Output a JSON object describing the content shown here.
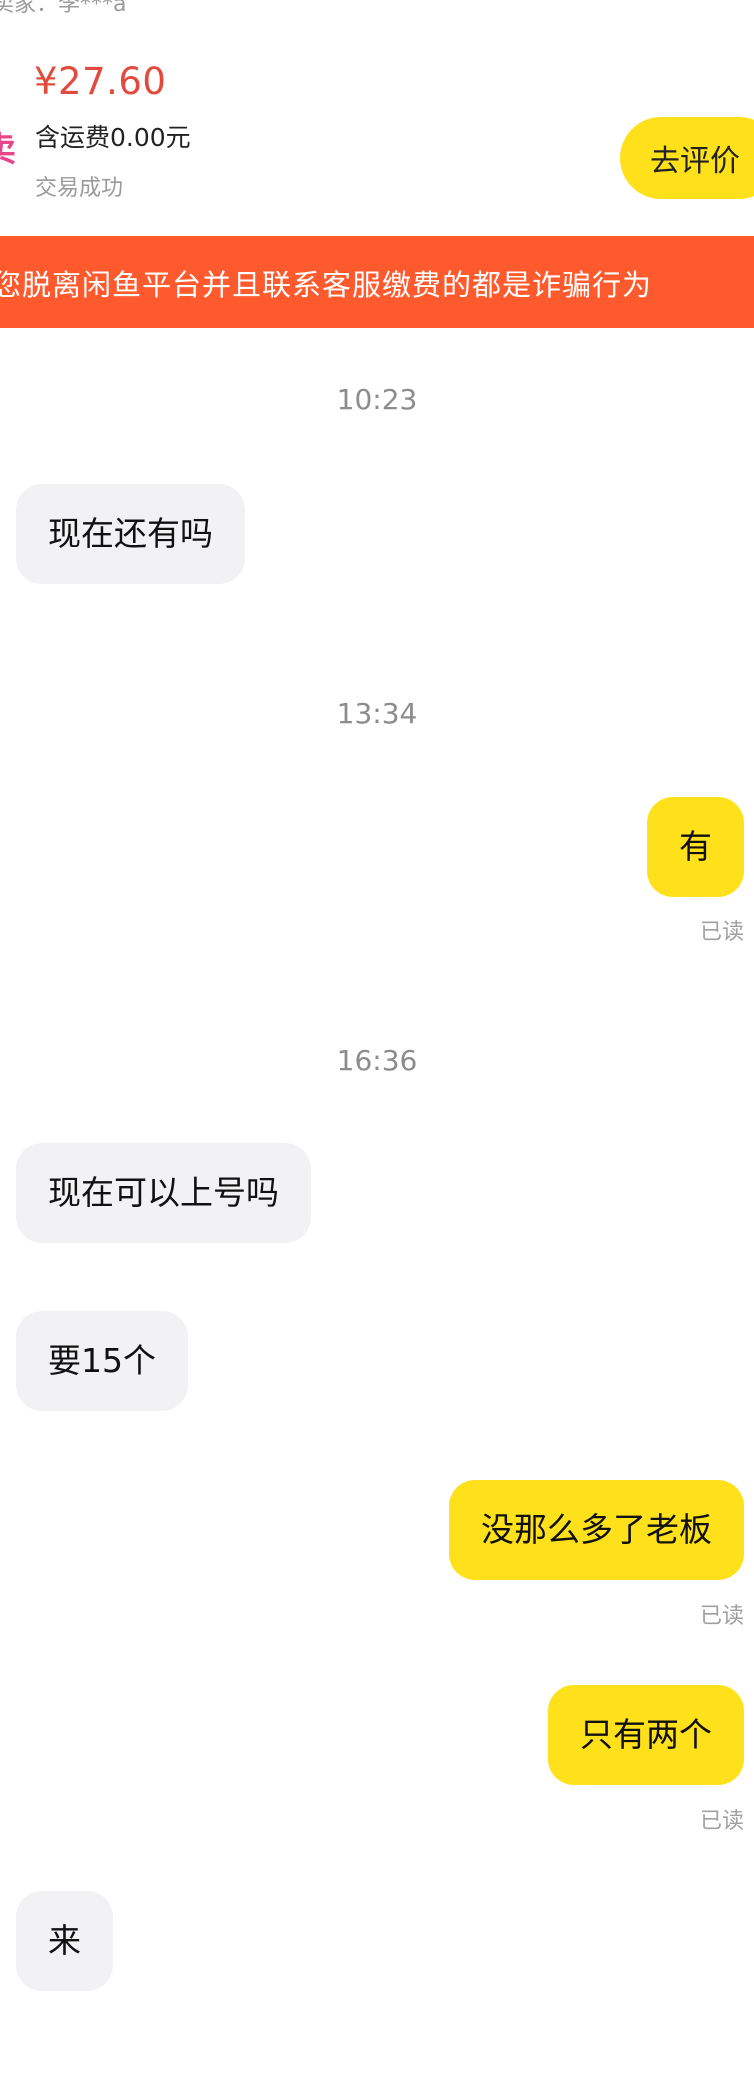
{
  "order": {
    "seller_line": "卖家：李***a",
    "thumb_mark": "卖",
    "price": "¥27.60",
    "shipping": "含运费0.00元",
    "status": "交易成功",
    "review_button": "去评价"
  },
  "warning": {
    "text": "您脱离闲鱼平台并且联系客服缴费的都是诈骗行为"
  },
  "chat": {
    "timestamps": [
      "10:23",
      "13:34",
      "16:36"
    ],
    "messages": [
      {
        "side": "incoming",
        "text": "现在还有吗"
      },
      {
        "side": "outgoing",
        "text": "有",
        "receipt": "已读"
      },
      {
        "side": "incoming",
        "text": "现在可以上号吗"
      },
      {
        "side": "incoming",
        "text": "要15个"
      },
      {
        "side": "outgoing",
        "text": "没那么多了老板",
        "receipt": "已读"
      },
      {
        "side": "outgoing",
        "text": "只有两个",
        "receipt": "已读"
      },
      {
        "side": "incoming",
        "text": "来"
      }
    ]
  },
  "colors": {
    "accent_yellow": "#ffe11b",
    "warning_orange": "#ff5a2e",
    "price_red": "#e14a3c",
    "incoming_bubble": "#f2f2f4"
  }
}
